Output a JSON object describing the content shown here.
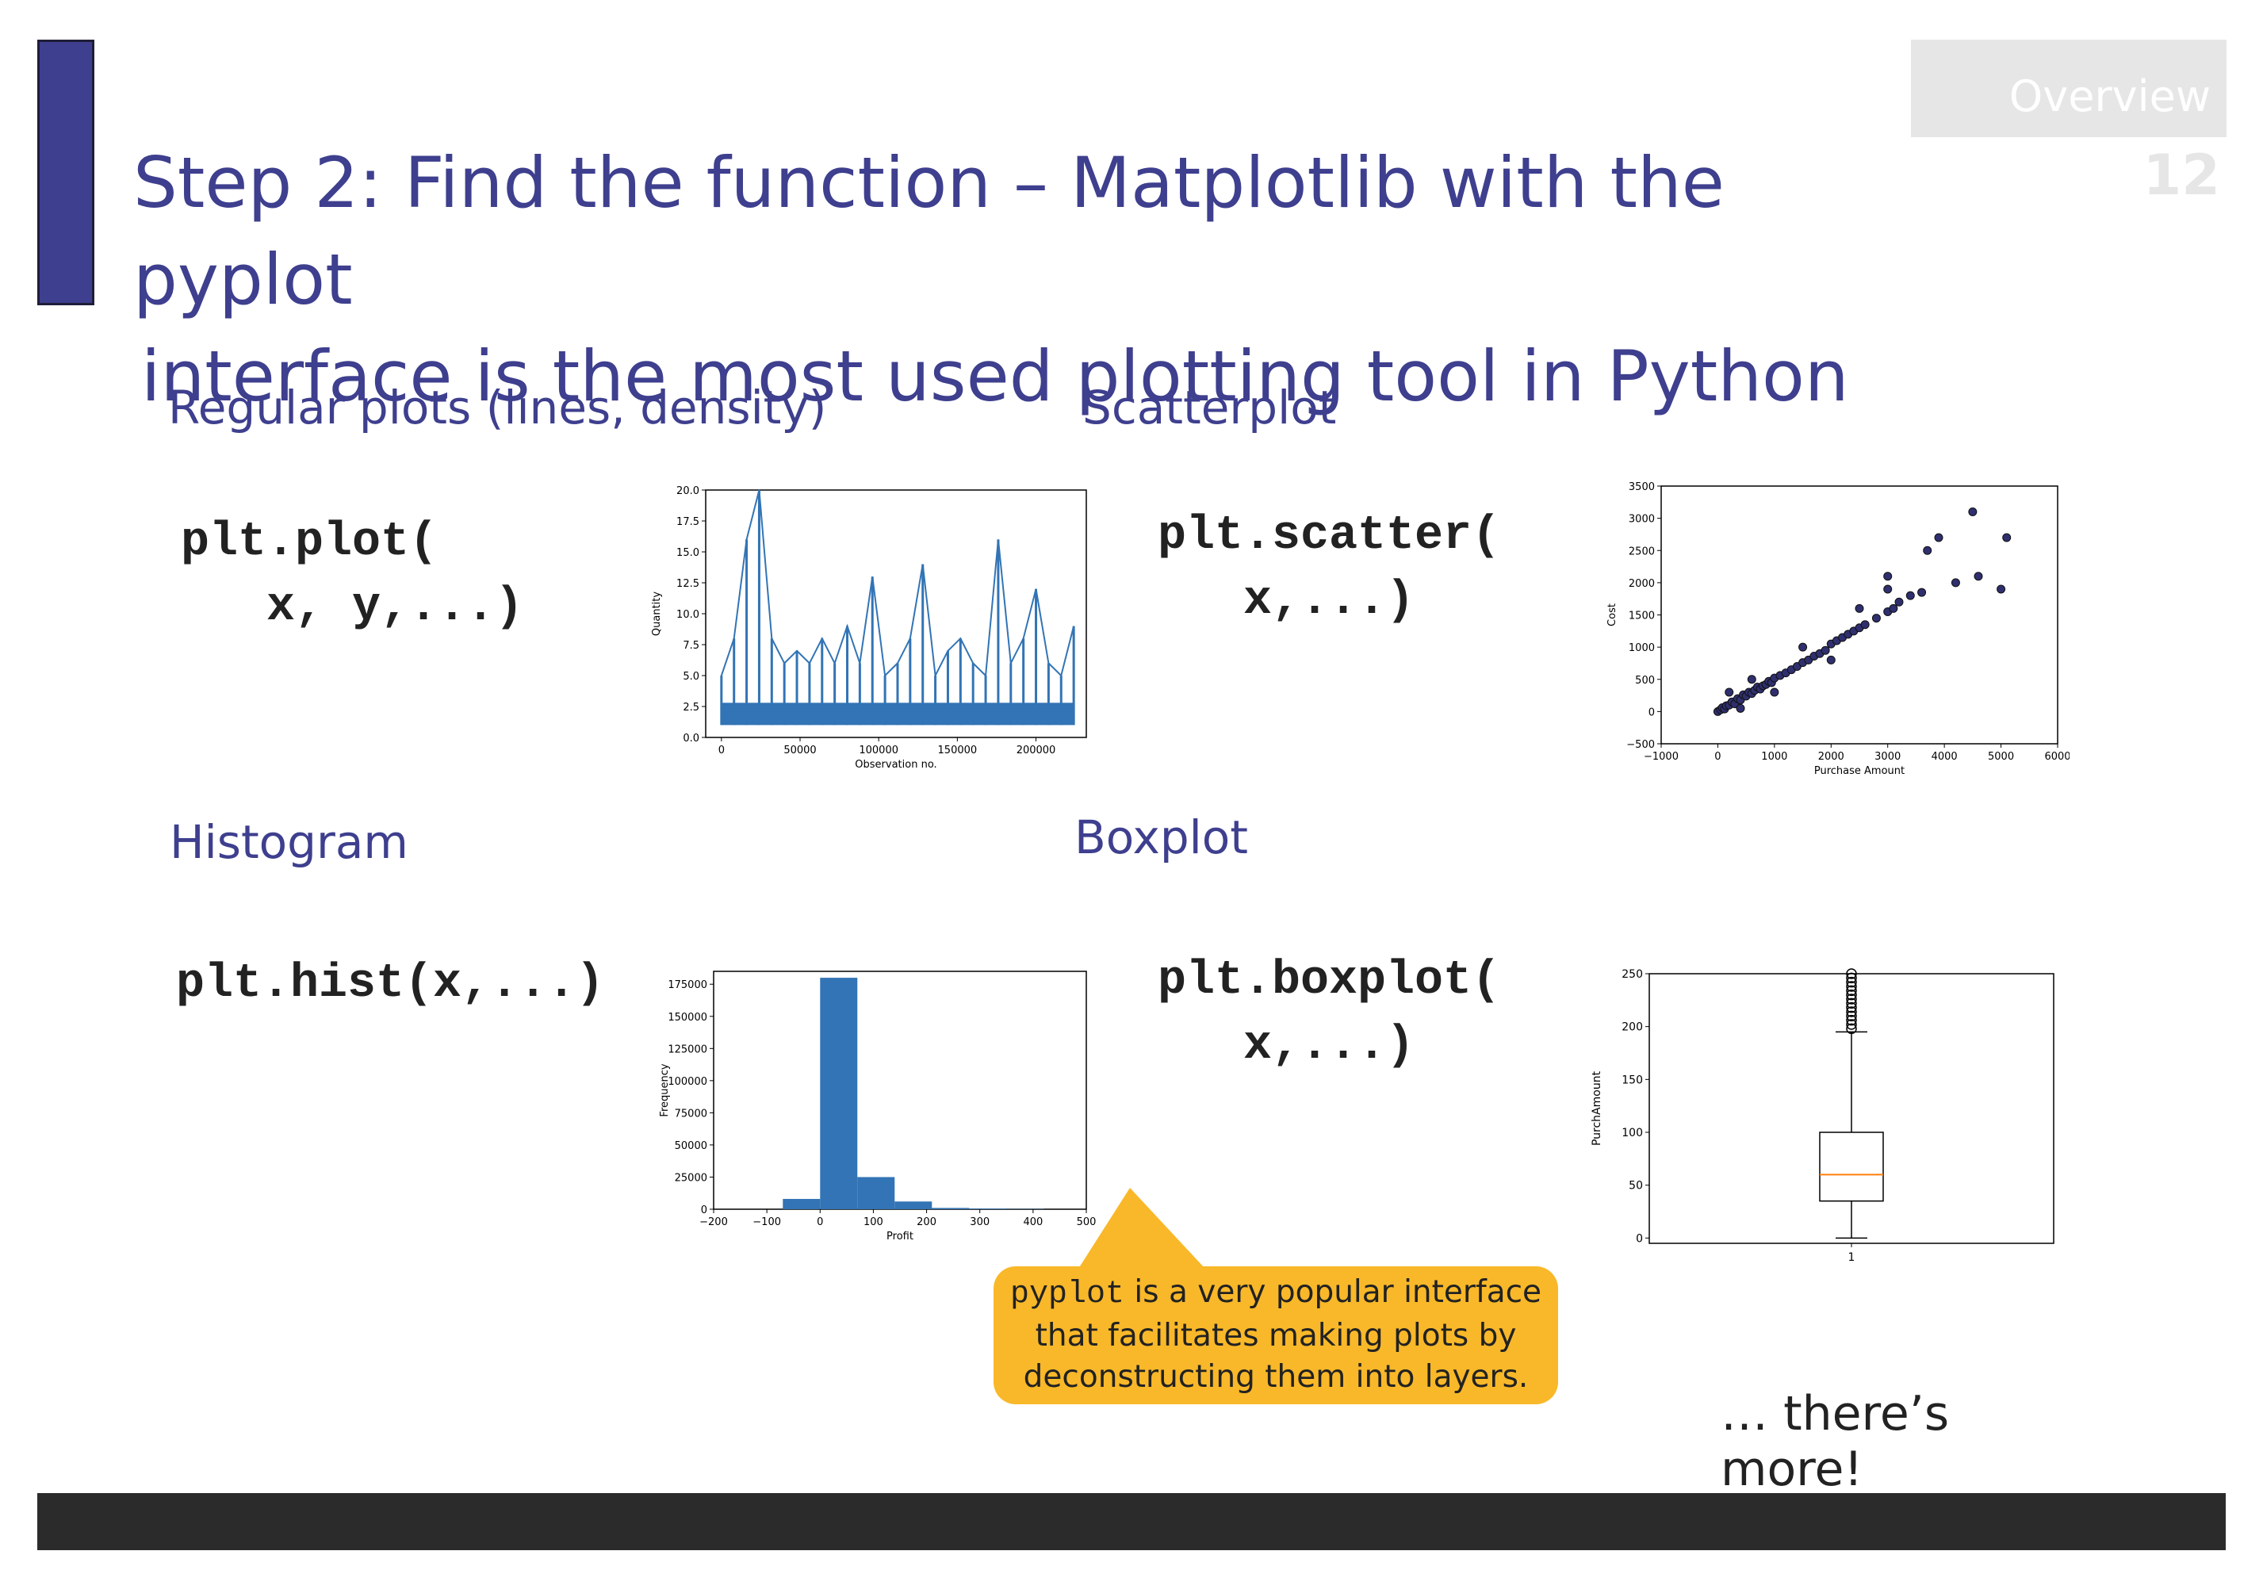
{
  "slide": {
    "overview": "Overview",
    "page_number": "12",
    "title_line1": "Step 2: Find the function – Matplotlib with the pyplot",
    "title_line2": "interface is the most used plotting tool in Python",
    "more": "… there’s more!"
  },
  "sections": {
    "regular": {
      "heading": "Regular plots (lines, density)",
      "code": "plt.plot(\n   x, y,...)"
    },
    "scatter": {
      "heading": "Scatterplot",
      "code": "plt.scatter(\n   x,...)"
    },
    "hist": {
      "heading": "Histogram",
      "code": "plt.hist(x,...)"
    },
    "box": {
      "heading": "Boxplot",
      "code": "plt.boxplot(\n   x,...)"
    }
  },
  "callout": {
    "code": "pyplot",
    "line1": " is a very popular interface",
    "line2": "that facilitates making plots by",
    "line3": "deconstructing them into layers."
  },
  "colors": {
    "accent": "#3e3f8e",
    "series": "#3274b5",
    "callout": "#f9b829",
    "scatter": "#2f2f6f",
    "median": "#ff7f0e"
  },
  "chart_data": [
    {
      "type": "line",
      "xlabel": "Observation no.",
      "ylabel": "Quantity",
      "xlim": [
        -10000,
        232000
      ],
      "ylim": [
        0,
        20
      ],
      "xticks": [
        "0",
        "50000",
        "100000",
        "150000",
        "200000"
      ],
      "yticks": [
        "0.0",
        "2.5",
        "5.0",
        "7.5",
        "10.0",
        "12.5",
        "15.0",
        "17.5",
        "20.0"
      ],
      "x": [
        0,
        8000,
        16000,
        24000,
        32000,
        40000,
        48000,
        56000,
        64000,
        72000,
        80000,
        88000,
        96000,
        104000,
        112000,
        120000,
        128000,
        136000,
        144000,
        152000,
        160000,
        168000,
        176000,
        184000,
        192000,
        200000,
        208000,
        216000,
        224000
      ],
      "y": [
        5,
        8,
        16,
        20,
        8,
        6,
        7,
        6,
        8,
        6,
        9,
        6,
        13,
        5,
        6,
        8,
        14,
        5,
        7,
        8,
        6,
        5,
        16,
        6,
        8,
        12,
        6,
        5,
        9
      ]
    },
    {
      "type": "scatter",
      "xlabel": "Purchase Amount",
      "ylabel": "Cost",
      "xlim": [
        -1000,
        6000
      ],
      "ylim": [
        -500,
        3500
      ],
      "xticks": [
        "−1000",
        "0",
        "1000",
        "2000",
        "3000",
        "4000",
        "5000",
        "6000"
      ],
      "yticks": [
        "−500",
        "0",
        "500",
        "1000",
        "1500",
        "2000",
        "2500",
        "3000",
        "3500"
      ],
      "points": [
        [
          0,
          0
        ],
        [
          50,
          30
        ],
        [
          80,
          60
        ],
        [
          120,
          40
        ],
        [
          150,
          90
        ],
        [
          200,
          100
        ],
        [
          250,
          150
        ],
        [
          300,
          120
        ],
        [
          350,
          200
        ],
        [
          400,
          180
        ],
        [
          450,
          260
        ],
        [
          500,
          240
        ],
        [
          550,
          300
        ],
        [
          600,
          280
        ],
        [
          650,
          330
        ],
        [
          700,
          380
        ],
        [
          750,
          350
        ],
        [
          800,
          400
        ],
        [
          850,
          420
        ],
        [
          900,
          470
        ],
        [
          950,
          450
        ],
        [
          1000,
          520
        ],
        [
          1100,
          560
        ],
        [
          1200,
          600
        ],
        [
          1300,
          650
        ],
        [
          1400,
          700
        ],
        [
          1500,
          760
        ],
        [
          1600,
          800
        ],
        [
          1700,
          860
        ],
        [
          1800,
          900
        ],
        [
          1900,
          950
        ],
        [
          2000,
          1050
        ],
        [
          2100,
          1100
        ],
        [
          2200,
          1150
        ],
        [
          2300,
          1200
        ],
        [
          2400,
          1250
        ],
        [
          2500,
          1300
        ],
        [
          2600,
          1350
        ],
        [
          2800,
          1450
        ],
        [
          3000,
          1550
        ],
        [
          3000,
          1900
        ],
        [
          3100,
          1600
        ],
        [
          3200,
          1700
        ],
        [
          3400,
          1800
        ],
        [
          3600,
          1850
        ],
        [
          3700,
          2500
        ],
        [
          3900,
          2700
        ],
        [
          4200,
          2000
        ],
        [
          4500,
          3100
        ],
        [
          4600,
          2100
        ],
        [
          5000,
          1900
        ],
        [
          5100,
          2700
        ],
        [
          2500,
          1600
        ],
        [
          3000,
          2100
        ],
        [
          200,
          300
        ],
        [
          600,
          500
        ],
        [
          1000,
          300
        ],
        [
          1500,
          1000
        ],
        [
          2000,
          800
        ],
        [
          400,
          50
        ]
      ]
    },
    {
      "type": "bar",
      "xlabel": "Profit",
      "ylabel": "Frequency",
      "xlim": [
        -200,
        500
      ],
      "ylim": [
        0,
        185000
      ],
      "xticks": [
        "−200",
        "−100",
        "0",
        "100",
        "200",
        "300",
        "400",
        "500"
      ],
      "yticks": [
        "0",
        "25000",
        "50000",
        "75000",
        "100000",
        "125000",
        "150000",
        "175000"
      ],
      "bins": [
        [
          -70,
          0
        ],
        [
          0,
          70
        ],
        [
          70,
          140
        ],
        [
          140,
          210
        ],
        [
          210,
          280
        ],
        [
          280,
          350
        ],
        [
          350,
          420
        ]
      ],
      "values": [
        8000,
        180000,
        25000,
        6000,
        1000,
        500,
        200
      ]
    },
    {
      "type": "boxplot",
      "xlabel": "",
      "ylabel": "PurchAmount",
      "ylim": [
        -5,
        250
      ],
      "xticks": [
        "1"
      ],
      "yticks": [
        "0",
        "50",
        "100",
        "150",
        "200",
        "250"
      ],
      "whisker_low": 0,
      "q1": 35,
      "median": 60,
      "q3": 100,
      "whisker_high": 195,
      "outliers": [
        198,
        202,
        206,
        210,
        214,
        218,
        222,
        226,
        230,
        234,
        238,
        242,
        246,
        250
      ]
    }
  ]
}
